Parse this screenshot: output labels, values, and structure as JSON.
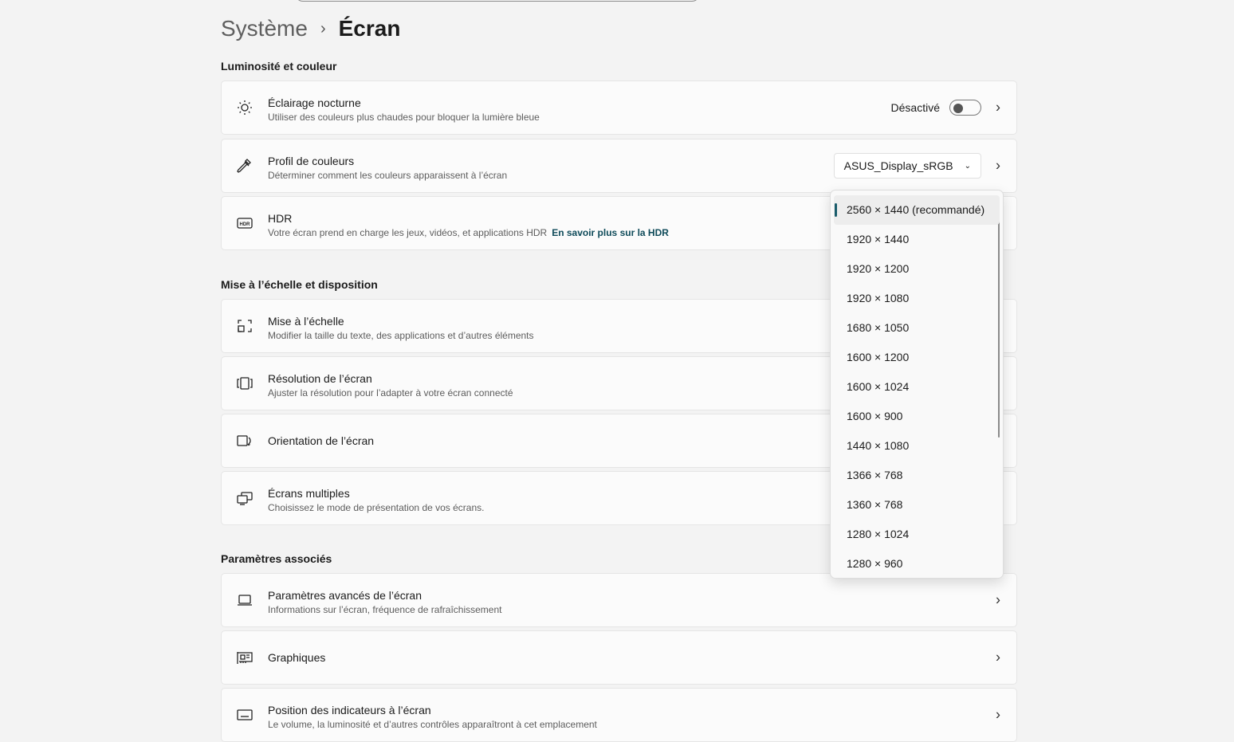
{
  "breadcrumb": {
    "parent": "Système",
    "current": "Écran"
  },
  "sections": [
    "Luminosité et couleur",
    "Mise à l’échelle et disposition",
    "Paramètres associés"
  ],
  "cards": [
    {
      "title": "Éclairage nocturne",
      "sub": "Utiliser des couleurs plus chaudes pour bloquer la lumière bleue",
      "icon": "brightness-icon",
      "status": "Désactivé"
    },
    {
      "title": "Profil de couleurs",
      "sub": "Déterminer comment les couleurs apparaissent à l’écran",
      "icon": "eyedropper-icon",
      "value": "ASUS_Display_sRGB"
    },
    {
      "title": "HDR",
      "sub": "Votre écran prend en charge les jeux, vidéos, et applications HDR",
      "link": "En savoir plus sur la HDR",
      "icon": "hdr-icon"
    },
    {
      "title": "Mise à l’échelle",
      "sub": "Modifier la taille du texte, des applications et d’autres éléments",
      "icon": "scale-icon"
    },
    {
      "title": "Résolution de l’écran",
      "sub": "Ajuster la résolution pour l’adapter à  votre  écran connecté",
      "icon": "resolution-icon"
    },
    {
      "title": "Orientation de l’écran",
      "icon": "orientation-icon"
    },
    {
      "title": "Écrans multiples",
      "sub": "Choisissez le mode de présentation de vos écrans.",
      "icon": "multi-display-icon"
    },
    {
      "title": "Paramètres avancés de l’écran",
      "sub": "Informations sur l’écran, fréquence de rafraîchissement",
      "icon": "laptop-icon"
    },
    {
      "title": "Graphiques",
      "icon": "graphics-card-icon"
    },
    {
      "title": "Position des indicateurs à l’écran",
      "sub": "Le volume, la luminosité et d’autres contrôles apparaîtront à cet emplacement",
      "icon": "indicator-icon"
    }
  ],
  "resolutions": [
    "2560 × 1440 (recommandé)",
    "1920 × 1440",
    "1920 × 1200",
    "1920 × 1080",
    "1680 × 1050",
    "1600 × 1200",
    "1600 × 1024",
    "1600 × 900",
    "1440 × 1080",
    "1366 × 768",
    "1360 × 768",
    "1280 × 1024",
    "1280 × 960"
  ],
  "colors": {
    "accent": "#1a5c6b"
  }
}
